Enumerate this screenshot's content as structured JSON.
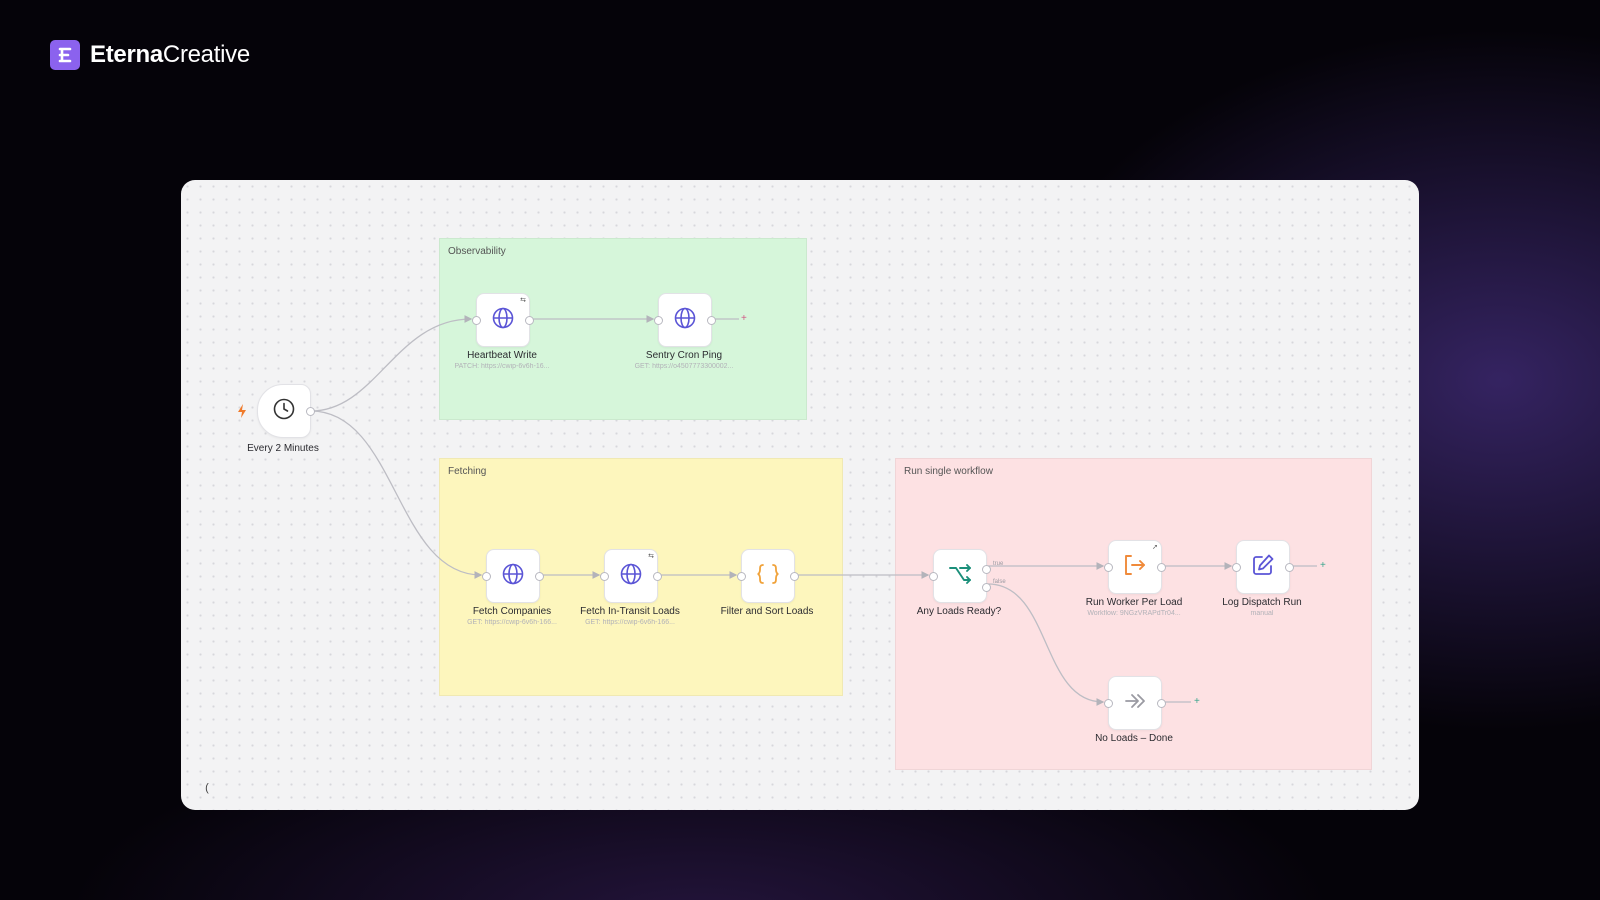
{
  "brand": {
    "name_bold": "Eterna",
    "name_regular": "Creative"
  },
  "groups": {
    "observability": "Observability",
    "fetching": "Fetching",
    "run": "Run single workflow"
  },
  "nodes": {
    "trigger": {
      "label": "Every 2 Minutes",
      "icon": "clock-icon"
    },
    "heartbeat": {
      "label": "Heartbeat Write",
      "sub": "PATCH: https://cwip-6v6h-16...",
      "icon": "globe-icon"
    },
    "sentry": {
      "label": "Sentry Cron Ping",
      "sub": "GET: https://o4507773300002...",
      "icon": "globe-icon"
    },
    "fetch_companies": {
      "label": "Fetch Companies",
      "sub": "GET: https://cwip-6v6h-166...",
      "icon": "globe-icon"
    },
    "fetch_loads": {
      "label": "Fetch In-Transit Loads",
      "sub": "GET: https://cwip-6v6h-166...",
      "icon": "globe-icon"
    },
    "filter": {
      "label": "Filter and Sort Loads",
      "icon": "code-braces-icon"
    },
    "any_loads": {
      "label": "Any Loads Ready?",
      "icon": "branch-icon",
      "true_label": "true",
      "false_label": "false"
    },
    "run_worker": {
      "label": "Run Worker Per Load",
      "sub": "Workflow: 9NGzVRAPdTr04...",
      "icon": "sign-in-icon"
    },
    "log_dispatch": {
      "label": "Log Dispatch Run",
      "sub": "manual",
      "icon": "edit-icon"
    },
    "no_loads": {
      "label": "No Loads – Done",
      "icon": "double-chevron-icon"
    }
  },
  "controls": {
    "add_symbol": "+",
    "collapse_symbol": "("
  },
  "colors": {
    "accent": "#8b62ee",
    "observability": "#d6f6da",
    "fetching": "#fdf6bd",
    "run": "#fde1e3",
    "globe": "#5b55d6",
    "branch": "#1b8f7a",
    "code": "#f0a23a",
    "worker": "#f08a3a"
  }
}
